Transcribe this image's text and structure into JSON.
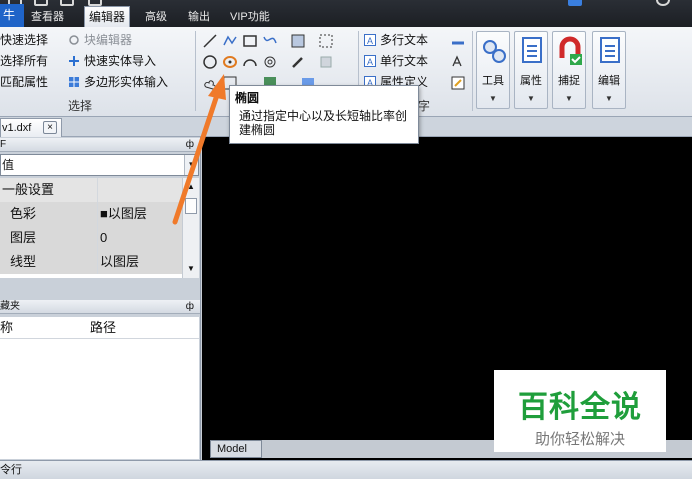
{
  "tabbar": {
    "file_tab": "牛",
    "tabs": [
      {
        "label": "查看器"
      },
      {
        "label": "编辑器"
      },
      {
        "label": "高级"
      },
      {
        "label": "输出"
      },
      {
        "label": "VIP功能"
      }
    ]
  },
  "ribbon": {
    "select_group": {
      "quick_select": "快速选择",
      "select_all": "选择所有",
      "match_props": "匹配属性",
      "block_editor": "块编辑器",
      "quick_import": "快速实体导入",
      "polygon_input": "多边形实体输入",
      "label": "选择"
    },
    "text_group": {
      "mtext": "多行文本",
      "stext": "单行文本",
      "attdef": "属性定义",
      "label_fragment": "字"
    },
    "big_buttons": [
      {
        "label": "工具",
        "icon": "tools-icon"
      },
      {
        "label": "属性",
        "icon": "properties-icon"
      },
      {
        "label": "捕捉",
        "icon": "snap-icon"
      },
      {
        "label": "编辑",
        "icon": "edit-icon"
      }
    ]
  },
  "tooltip": {
    "title": "椭圆",
    "body": "通过指定中心以及长短轴比率创建椭圆"
  },
  "docs": {
    "active": "v1.dxf",
    "close_glyph": "×"
  },
  "properties": {
    "title_fragment": "F",
    "pin_glyph": "ф",
    "combo_value": "值",
    "rows": [
      {
        "key": "一般设置",
        "value": ""
      },
      {
        "key": "色彩",
        "value": "■以图层"
      },
      {
        "key": "图层",
        "value": "0"
      },
      {
        "key": "线型",
        "value": "以图层"
      }
    ]
  },
  "filelist": {
    "title_fragment": "藏夹",
    "col_name": "称",
    "col_path": "路径"
  },
  "canvas": {
    "model_tab": "Model"
  },
  "watermark": {
    "title": "百科全说",
    "subtitle": "助你轻松解决"
  },
  "statusbar": {
    "text": "令行"
  },
  "colors": {
    "tab_bar": "#1c1f24",
    "file_tab": "#1f64c8",
    "arrow": "#f07a2a",
    "watermark_green": "#1f9e3b",
    "canvas_bg": "#000000"
  }
}
